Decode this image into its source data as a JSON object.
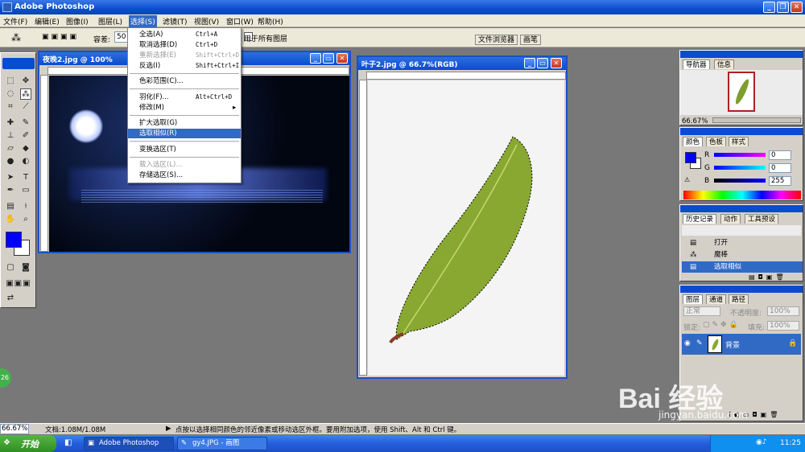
{
  "app": {
    "title": "Adobe Photoshop"
  },
  "menubar": [
    "文件(F)",
    "编辑(E)",
    "图像(I)",
    "图层(L)",
    "选择(S)",
    "滤镜(T)",
    "视图(V)",
    "窗口(W)",
    "帮助(H)"
  ],
  "options": {
    "tolerance_label": "容差:",
    "tolerance_value": "50",
    "sample_all_layers": "用于所有图层",
    "file_browser_tab": "文件浏览器",
    "brushes_tab": "画笔"
  },
  "select_menu": {
    "items": [
      {
        "label": "全选(A)",
        "shortcut": "Ctrl+A",
        "disabled": false
      },
      {
        "label": "取消选择(D)",
        "shortcut": "Ctrl+D",
        "disabled": false
      },
      {
        "label": "重新选择(E)",
        "shortcut": "Shift+Ctrl+D",
        "disabled": true
      },
      {
        "label": "反选(I)",
        "shortcut": "Shift+Ctrl+I",
        "disabled": false
      },
      {
        "label": "色彩范围(C)...",
        "shortcut": "",
        "disabled": false
      },
      {
        "label": "羽化(F)...",
        "shortcut": "Alt+Ctrl+D",
        "disabled": false
      },
      {
        "label": "修改(M)",
        "shortcut": "",
        "disabled": false
      },
      {
        "label": "扩大选取(G)",
        "shortcut": "",
        "disabled": false
      },
      {
        "label": "选取相似(R)",
        "shortcut": "",
        "disabled": false
      },
      {
        "label": "变换选区(T)",
        "shortcut": "",
        "disabled": false
      },
      {
        "label": "载入选区(L)...",
        "shortcut": "",
        "disabled": true
      },
      {
        "label": "存储选区(S)...",
        "shortcut": "",
        "disabled": false
      }
    ]
  },
  "doc1": {
    "title": "夜晚2.jpg @ 100%"
  },
  "doc2": {
    "title": "叶子2.jpg @ 66.7%(RGB)"
  },
  "navigator": {
    "tabs": [
      "导航器",
      "信息"
    ],
    "zoom": "66.67%"
  },
  "color_panel": {
    "tabs": [
      "颜色",
      "色板",
      "样式"
    ],
    "r_label": "R",
    "g_label": "G",
    "b_label": "B",
    "r": "0",
    "g": "0",
    "b": "255"
  },
  "history_panel": {
    "tabs": [
      "历史记录",
      "动作",
      "工具预设"
    ],
    "items": [
      "打开",
      "魔棒",
      "选取相似"
    ]
  },
  "layers_panel": {
    "tabs": [
      "图层",
      "通道",
      "路径"
    ],
    "blend_mode": "正常",
    "opacity_label": "不透明度:",
    "opacity": "100%",
    "lock_label": "锁定:",
    "fill_label": "填充:",
    "fill": "100%",
    "layer_name": "背景"
  },
  "status": {
    "zoom": "66.67%",
    "doc_size": "文档:1.08M/1.08M",
    "hint": "点按以选择相同颜色的邻近像素或移动选区外框。要用附加选项，使用 Shift、Alt 和 Ctrl 键。"
  },
  "taskbar": {
    "start": "开始",
    "tasks": [
      "Adobe Photoshop",
      "gy4.JPG - 画图"
    ],
    "time": "11:25"
  },
  "watermark": {
    "brand": "Bai 经验",
    "url": "jingyan.baidu.com"
  },
  "badge": "26",
  "colors": {
    "foreground": "#0000ff",
    "background": "#ffffff",
    "xp_blue": "#0a4bd0",
    "menu_highlight": "#316ac5"
  }
}
